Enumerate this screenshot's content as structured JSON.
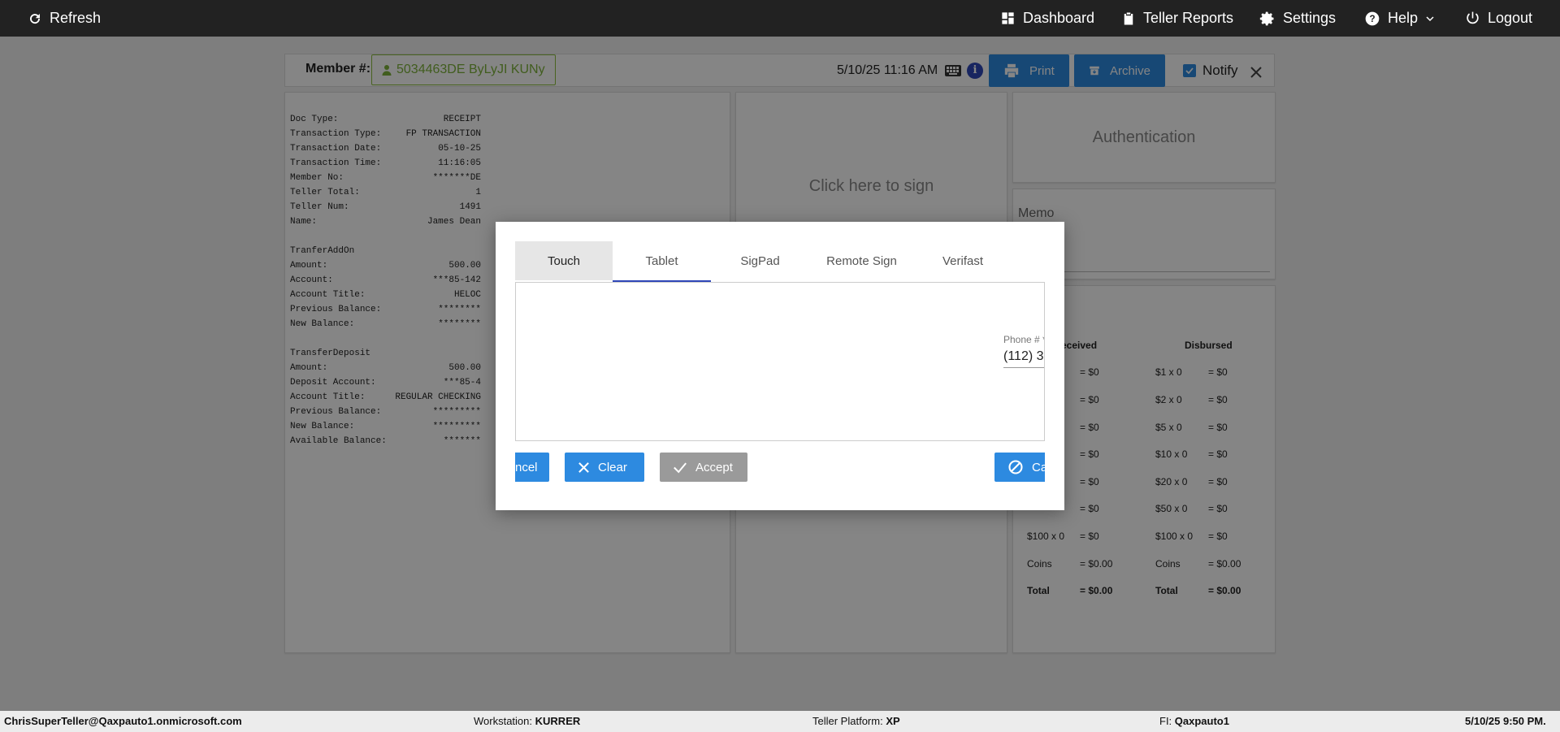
{
  "topnav": {
    "refresh": "Refresh",
    "dashboard": "Dashboard",
    "teller_reports": "Teller Reports",
    "settings": "Settings",
    "help": "Help",
    "logout": "Logout"
  },
  "member_bar": {
    "label": "Member #:",
    "member_value": "5034463DE ByLyJI KUNy",
    "timestamp": "5/10/25 11:16 AM",
    "info_glyph": "i",
    "print": "Print",
    "archive": "Archive",
    "notify": "Notify",
    "notify_checked": true
  },
  "receipt": {
    "rows": [
      {
        "k": "Doc Type:",
        "v": "RECEIPT"
      },
      {
        "k": "Transaction Type:",
        "v": "FP TRANSACTION"
      },
      {
        "k": "Transaction Date:",
        "v": "05-10-25"
      },
      {
        "k": "Transaction Time:",
        "v": "11:16:05"
      },
      {
        "k": "Member No:",
        "v": "*******DE"
      },
      {
        "k": "Teller Total:",
        "v": "1"
      },
      {
        "k": "Teller Num:",
        "v": "1491"
      },
      {
        "k": "Name:",
        "v": "James Dean"
      },
      {
        "gap": true
      },
      {
        "k": "TranferAddOn",
        "v": ""
      },
      {
        "k": "Amount:",
        "v": "500.00"
      },
      {
        "k": "Account:",
        "v": "***85-142"
      },
      {
        "k": "Account Title:",
        "v": "HELOC"
      },
      {
        "k": "Previous Balance:",
        "v": "********"
      },
      {
        "k": "New Balance:",
        "v": "********"
      },
      {
        "gap": true
      },
      {
        "k": "TransferDeposit",
        "v": ""
      },
      {
        "k": "Amount:",
        "v": "500.00"
      },
      {
        "k": "Deposit Account:",
        "v": "***85-4"
      },
      {
        "k": "Account Title:",
        "v": "REGULAR CHECKING"
      },
      {
        "k": "Previous Balance:",
        "v": "*********"
      },
      {
        "k": "New Balance:",
        "v": "*********"
      },
      {
        "k": "Available Balance:",
        "v": "*******"
      }
    ]
  },
  "sign_panel": {
    "text": "Click here to sign"
  },
  "auth_panel": {
    "text": "Authentication"
  },
  "memo_panel": {
    "label": "Memo"
  },
  "cash": {
    "received_header": "eceived",
    "disbursed_header": "Disbursed",
    "received_rows": [
      {
        "label": "",
        "amount": "= $0"
      },
      {
        "label": "",
        "amount": "= $0"
      },
      {
        "label": "",
        "amount": "= $0"
      },
      {
        "label": "",
        "amount": "= $0"
      },
      {
        "label": "",
        "amount": "= $0"
      },
      {
        "label": "",
        "amount": "= $0"
      },
      {
        "label": "$100 x 0",
        "amount": "= $0"
      },
      {
        "label": "Coins",
        "amount": "= $0.00"
      },
      {
        "label": "Total",
        "amount": "= $0.00",
        "bold": true
      }
    ],
    "disbursed_rows": [
      {
        "label": "$1 x 0",
        "amount": "= $0"
      },
      {
        "label": "$2 x 0",
        "amount": "= $0"
      },
      {
        "label": "$5 x 0",
        "amount": "= $0"
      },
      {
        "label": "$10 x 0",
        "amount": "= $0"
      },
      {
        "label": "$20 x 0",
        "amount": "= $0"
      },
      {
        "label": "$50 x 0",
        "amount": "= $0"
      },
      {
        "label": "$100 x 0",
        "amount": "= $0"
      },
      {
        "label": "Coins",
        "amount": "= $0.00"
      },
      {
        "label": "Total",
        "amount": "= $0.00",
        "bold": true
      }
    ]
  },
  "modal": {
    "tabs": [
      "Touch",
      "Tablet",
      "SigPad",
      "Remote Sign",
      "Verifast"
    ],
    "active_tab": "Touch",
    "underlined_tab": "Tablet",
    "phone_label": "Phone # *",
    "phone_value": "(112) 3",
    "cancel_left": "ncel",
    "clear": "Clear",
    "accept": "Accept",
    "cancel_right": "Ca"
  },
  "footer": {
    "user": "ChrisSuperTeller@Qaxpauto1.onmicrosoft.com",
    "workstation_label": "Workstation:",
    "workstation": "KURRER",
    "platform_label": "Teller Platform:",
    "platform": "XP",
    "fi_label": "FI:",
    "fi": "Qaxpauto1",
    "datetime": "5/10/25 9:50 PM."
  },
  "colors": {
    "nav_bg": "#222222",
    "primary_blue": "#2d8ae0",
    "member_green": "#7db33a",
    "tab_underline": "#2f47b8"
  }
}
